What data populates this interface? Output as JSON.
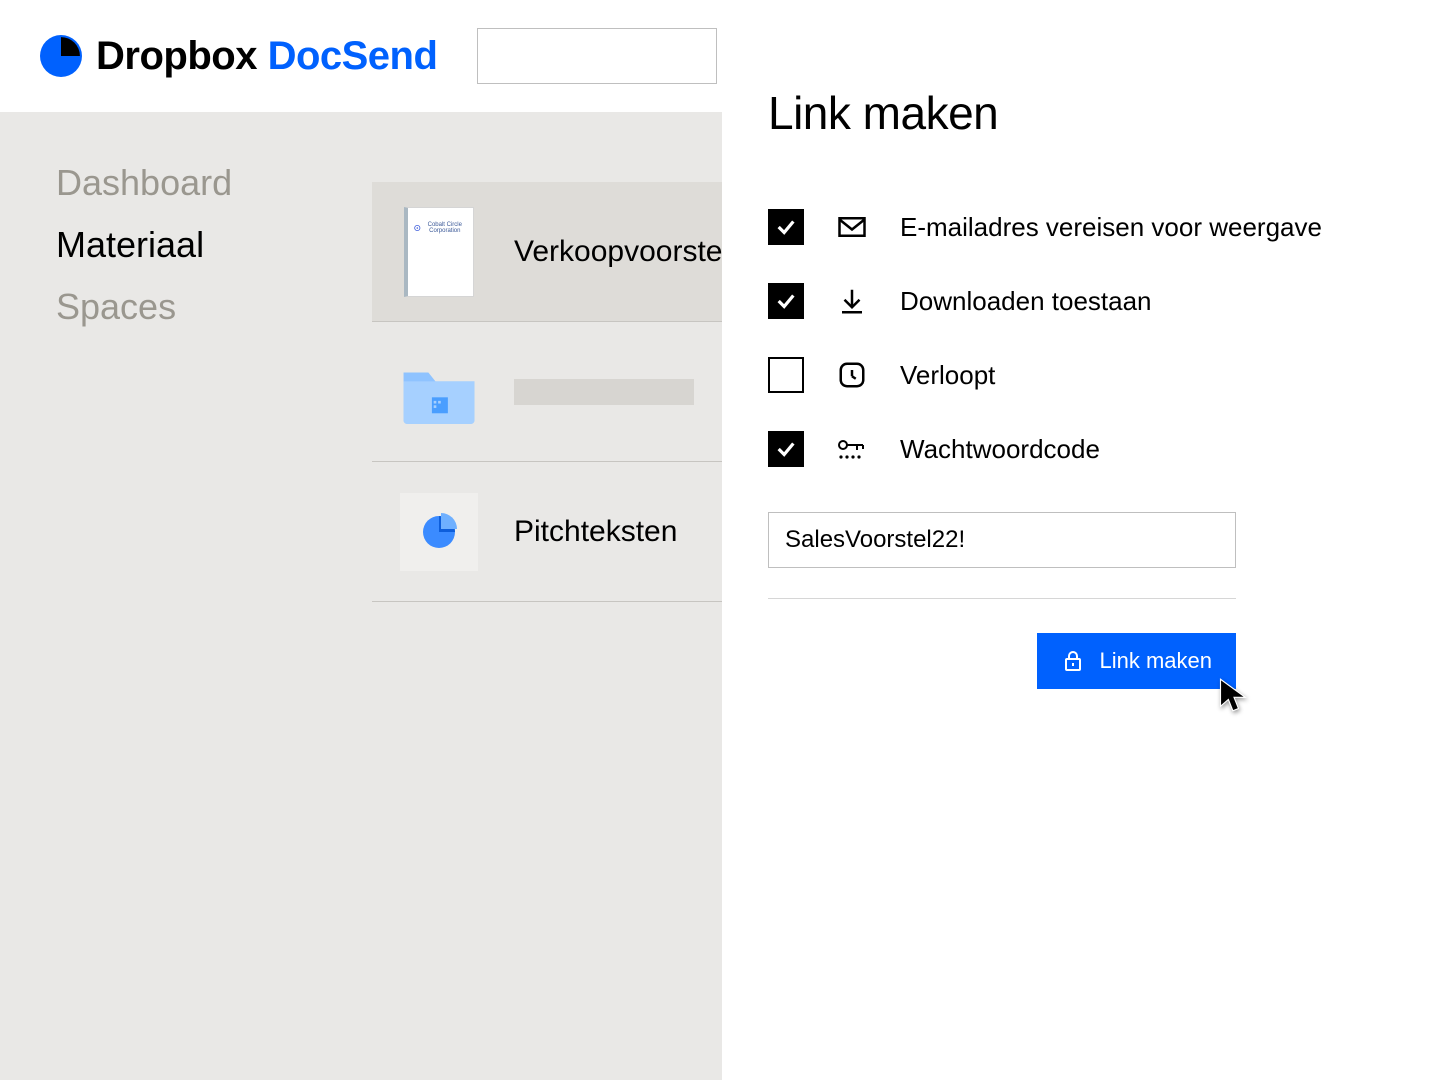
{
  "brand": {
    "dropbox": "Dropbox",
    "docsend": "DocSend"
  },
  "colors": {
    "accent": "#0061fe"
  },
  "search": {
    "placeholder": ""
  },
  "sidebar": {
    "items": [
      {
        "label": "Dashboard",
        "active": false
      },
      {
        "label": "Materiaal",
        "active": true
      },
      {
        "label": "Spaces",
        "active": false
      }
    ]
  },
  "list": {
    "items": [
      {
        "label": "Verkoopvoorstel",
        "thumb_text": "Cobalt Circle Corporation"
      },
      {
        "label": ""
      },
      {
        "label": "Pitchteksten"
      }
    ]
  },
  "panel": {
    "title": "Link maken",
    "options": [
      {
        "label": "E-mailadres vereisen voor weergave",
        "checked": true
      },
      {
        "label": "Downloaden toestaan",
        "checked": true
      },
      {
        "label": "Verloopt",
        "checked": false
      },
      {
        "label": "Wachtwoordcode",
        "checked": true
      }
    ],
    "password_value": "SalesVoorstel22!",
    "button_label": "Link maken"
  }
}
